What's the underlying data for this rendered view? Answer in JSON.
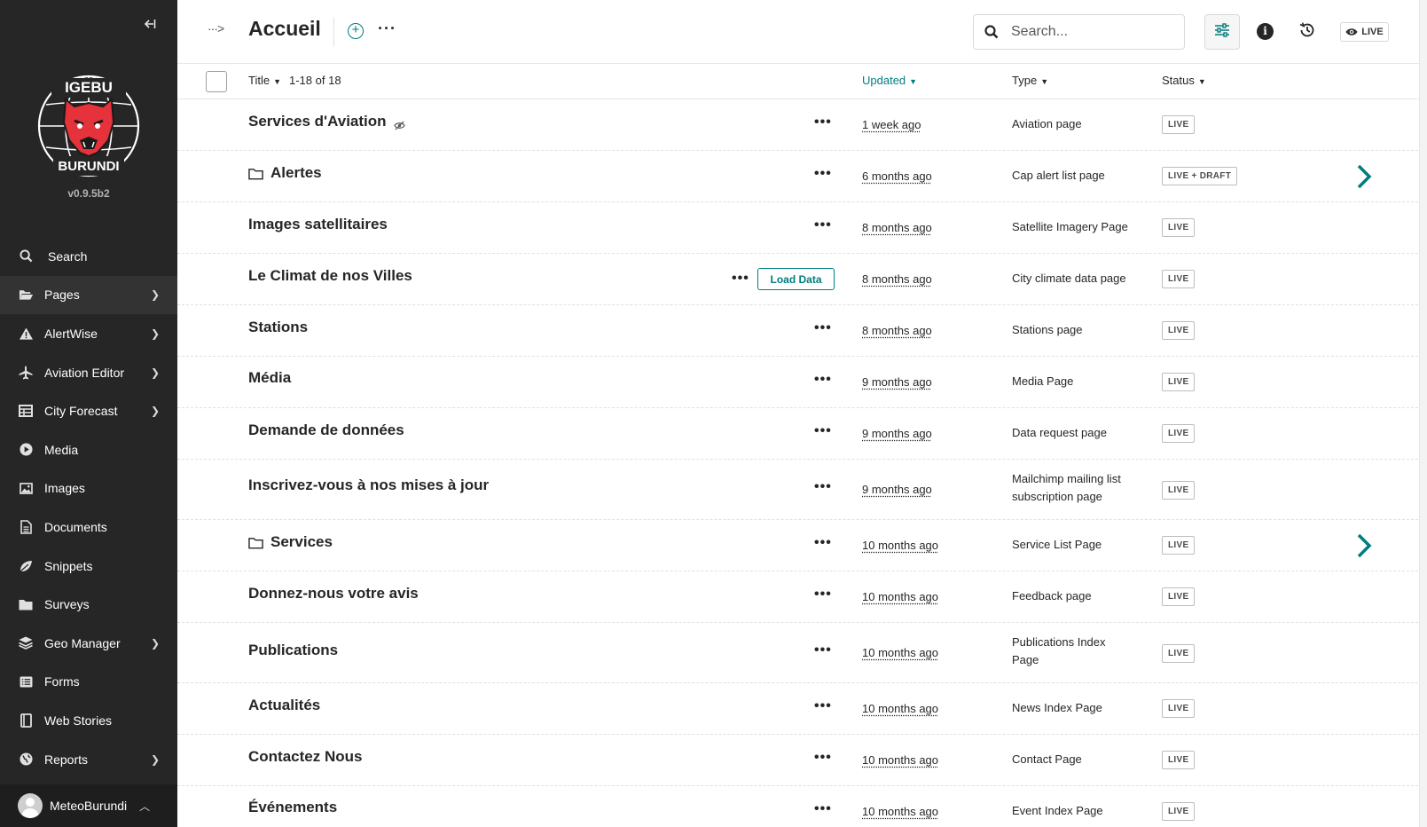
{
  "sidebar": {
    "brand_version": "v0.9.5b2",
    "logo_text_top": "IGEBU",
    "logo_text_bottom": "BURUNDI",
    "items": [
      {
        "label": "Search",
        "icon": "search-icon",
        "has_children": false
      },
      {
        "label": "Pages",
        "icon": "folder-open-icon",
        "has_children": true
      },
      {
        "label": "AlertWise",
        "icon": "warning-icon",
        "has_children": true
      },
      {
        "label": "Aviation Editor",
        "icon": "plane-icon",
        "has_children": true
      },
      {
        "label": "City Forecast",
        "icon": "table-icon",
        "has_children": true
      },
      {
        "label": "Media",
        "icon": "play-icon",
        "has_children": false
      },
      {
        "label": "Images",
        "icon": "image-icon",
        "has_children": false
      },
      {
        "label": "Documents",
        "icon": "document-icon",
        "has_children": false
      },
      {
        "label": "Snippets",
        "icon": "snippet-icon",
        "has_children": false
      },
      {
        "label": "Surveys",
        "icon": "folder-icon",
        "has_children": false
      },
      {
        "label": "Geo Manager",
        "icon": "layers-icon",
        "has_children": true
      },
      {
        "label": "Forms",
        "icon": "list-icon",
        "has_children": false
      },
      {
        "label": "Web Stories",
        "icon": "book-icon",
        "has_children": false
      },
      {
        "label": "Reports",
        "icon": "globe-icon",
        "has_children": true
      }
    ],
    "account_name": "MeteoBurundi"
  },
  "header": {
    "title": "Accueil",
    "search_placeholder": "Search...",
    "live_label": "LIVE"
  },
  "table": {
    "columns": {
      "title": "Title",
      "count": "1-18 of 18",
      "updated": "Updated",
      "type": "Type",
      "status": "Status"
    },
    "load_data_label": "Load Data",
    "rows": [
      {
        "title": "Services d'Aviation",
        "updated": "1 week ago",
        "type": "Aviation page",
        "status": "LIVE",
        "folder": false,
        "hidden": true,
        "children": false
      },
      {
        "title": "Alertes",
        "updated": "6 months ago",
        "type": "Cap alert list page",
        "status": "LIVE + DRAFT",
        "folder": true,
        "hidden": false,
        "children": true
      },
      {
        "title": "Images satellitaires",
        "updated": "8 months ago",
        "type": "Satellite Imagery Page",
        "status": "LIVE",
        "folder": false,
        "hidden": false,
        "children": false
      },
      {
        "title": "Le Climat de nos Villes",
        "updated": "8 months ago",
        "type": "City climate data page",
        "status": "LIVE",
        "folder": false,
        "hidden": false,
        "children": false,
        "load_data": true
      },
      {
        "title": "Stations",
        "updated": "8 months ago",
        "type": "Stations page",
        "status": "LIVE",
        "folder": false,
        "hidden": false,
        "children": false
      },
      {
        "title": "Média",
        "updated": "9 months ago",
        "type": "Media Page",
        "status": "LIVE",
        "folder": false,
        "hidden": false,
        "children": false
      },
      {
        "title": "Demande de données",
        "updated": "9 months ago",
        "type": "Data request page",
        "status": "LIVE",
        "folder": false,
        "hidden": false,
        "children": false
      },
      {
        "title": "Inscrivez-vous à nos mises à jour",
        "updated": "9 months ago",
        "type": "Mailchimp mailing list subscription page",
        "status": "LIVE",
        "folder": false,
        "hidden": false,
        "children": false
      },
      {
        "title": "Services",
        "updated": "10 months ago",
        "type": "Service List Page",
        "status": "LIVE",
        "folder": true,
        "hidden": false,
        "children": true
      },
      {
        "title": "Donnez-nous votre avis",
        "updated": "10 months ago",
        "type": "Feedback page",
        "status": "LIVE",
        "folder": false,
        "hidden": false,
        "children": false
      },
      {
        "title": "Publications",
        "updated": "10 months ago",
        "type": "Publications Index Page",
        "status": "LIVE",
        "folder": false,
        "hidden": false,
        "children": false
      },
      {
        "title": "Actualités",
        "updated": "10 months ago",
        "type": "News Index Page",
        "status": "LIVE",
        "folder": false,
        "hidden": false,
        "children": false
      },
      {
        "title": "Contactez Nous",
        "updated": "10 months ago",
        "type": "Contact Page",
        "status": "LIVE",
        "folder": false,
        "hidden": false,
        "children": false
      },
      {
        "title": "Événements",
        "updated": "10 months ago",
        "type": "Event Index Page",
        "status": "LIVE",
        "folder": false,
        "hidden": false,
        "children": false
      }
    ]
  },
  "colors": {
    "sidebar_bg": "#262626",
    "accent": "#007d7e",
    "logo_red": "#e5323b"
  }
}
